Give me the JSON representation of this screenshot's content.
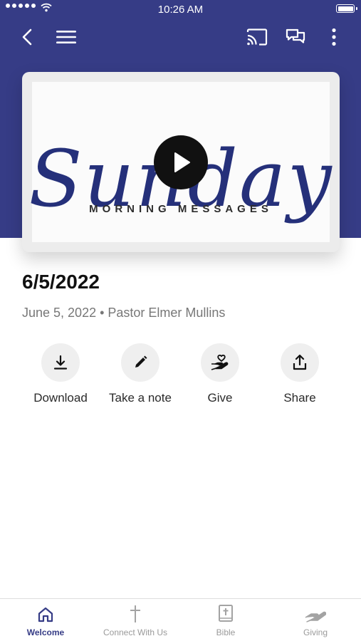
{
  "status_bar": {
    "time": "10:26 AM"
  },
  "media": {
    "script_title": "Sunday",
    "subtitle": "MORNING MESSAGES"
  },
  "sermon": {
    "title": "6/5/2022",
    "meta": "June 5, 2022 • Pastor Elmer Mullins"
  },
  "actions": [
    {
      "label": "Download",
      "icon": "download-icon"
    },
    {
      "label": "Take a note",
      "icon": "pencil-icon"
    },
    {
      "label": "Give",
      "icon": "heart-hand-icon"
    },
    {
      "label": "Share",
      "icon": "share-icon"
    }
  ],
  "tabs": [
    {
      "label": "Welcome",
      "icon": "home-icon",
      "active": true
    },
    {
      "label": "Connect With Us",
      "icon": "cross-icon",
      "active": false
    },
    {
      "label": "Bible",
      "icon": "bible-icon",
      "active": false
    },
    {
      "label": "Giving",
      "icon": "giving-hand-icon",
      "active": false
    }
  ],
  "colors": {
    "brand": "#363c86",
    "script": "#25307a",
    "inactive": "#9a9a9a"
  }
}
